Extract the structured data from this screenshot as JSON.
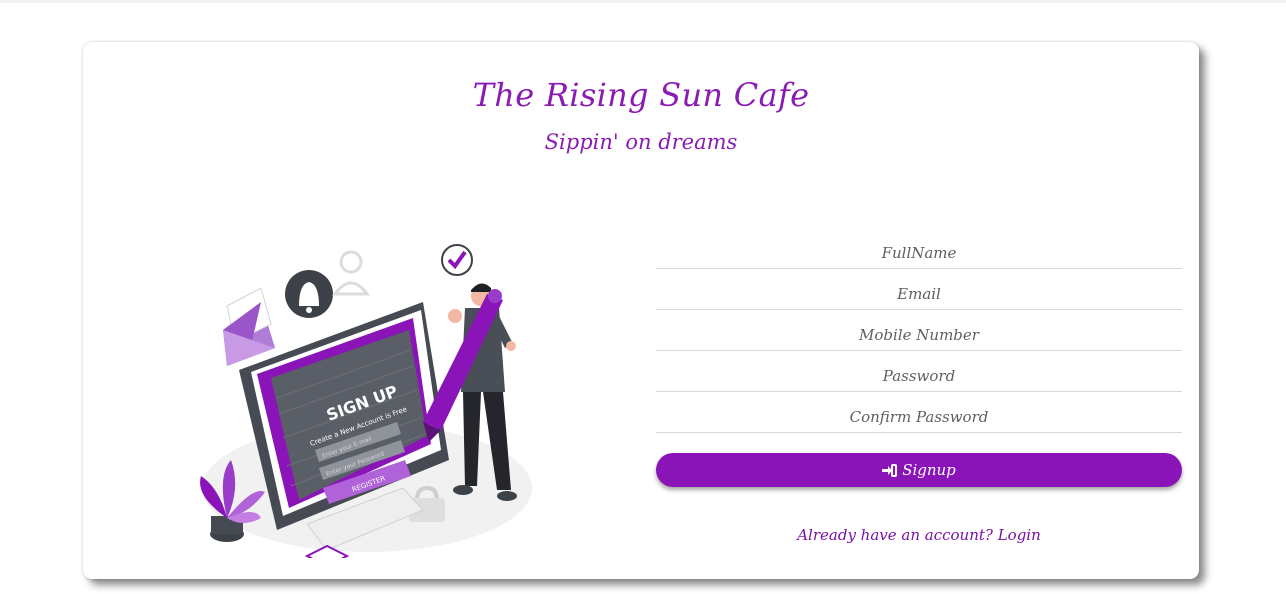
{
  "brand": {
    "title": "The Rising Sun Cafe",
    "tagline": "Sippin' on dreams"
  },
  "illustration": {
    "heading": "SIGN UP",
    "subheading": "Create a New Account is Free",
    "email_placeholder": "Enter your E-mail",
    "password_placeholder": "Enter your Password",
    "button_label": "REGISTER",
    "icon": "signup-illustration"
  },
  "form": {
    "fullname_placeholder": "FullName",
    "email_placeholder": "Email",
    "mobile_placeholder": "Mobile Number",
    "password_placeholder": "Password",
    "confirm_placeholder": "Confirm Password",
    "signup_label": "Signup",
    "signup_icon": "sign-in-icon"
  },
  "footer": {
    "login_text": "Already have an account? Login"
  },
  "colors": {
    "accent": "#8a14b8",
    "text_purple": "#8a1bb3"
  }
}
